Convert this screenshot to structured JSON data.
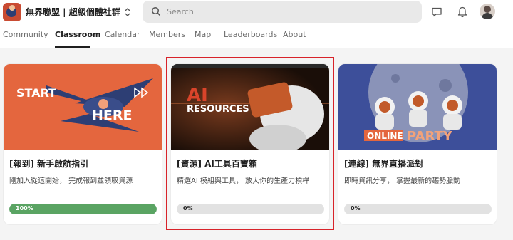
{
  "header": {
    "community_name": "無界聯盟 | 超級個體社群",
    "search_placeholder": "Search"
  },
  "nav": {
    "tabs": [
      {
        "label": "Community",
        "active": false
      },
      {
        "label": "Classroom",
        "active": true
      },
      {
        "label": "Calendar",
        "active": false
      },
      {
        "label": "Members",
        "active": false
      },
      {
        "label": "Map",
        "active": false
      },
      {
        "label": "Leaderboards",
        "active": false
      },
      {
        "label": "About",
        "active": false
      }
    ]
  },
  "courses": [
    {
      "banner_text_1": "START",
      "banner_text_2": "HERE",
      "title": "[報到] 新手啟航指引",
      "description": "剛加入從這開始， 完成報到並領取資源",
      "progress": 100,
      "progress_label": "100%"
    },
    {
      "banner_text_1": "AI",
      "banner_text_2": "RESOURCES",
      "title": "[資源] AI工具百寶箱",
      "description": "精選AI 模組與工具， 放大你的生產力槓桿",
      "progress": 0,
      "progress_label": "0%"
    },
    {
      "banner_text_1": "ONLINE",
      "banner_text_2": "PARTY",
      "title": "[連線] 無界直播派對",
      "description": "即時資訊分享， 掌握最新的趨勢脈動",
      "progress": 0,
      "progress_label": "0%"
    }
  ],
  "colors": {
    "accent_highlight": "#d8232a",
    "progress_fill": "#5aa463",
    "card1_bg": "#e4663e",
    "card2_bg": "#2a1a12",
    "card3_bg": "#3d4f9a"
  },
  "icons": [
    "search-icon",
    "chat-icon",
    "bell-icon",
    "chevron-updown-icon"
  ]
}
